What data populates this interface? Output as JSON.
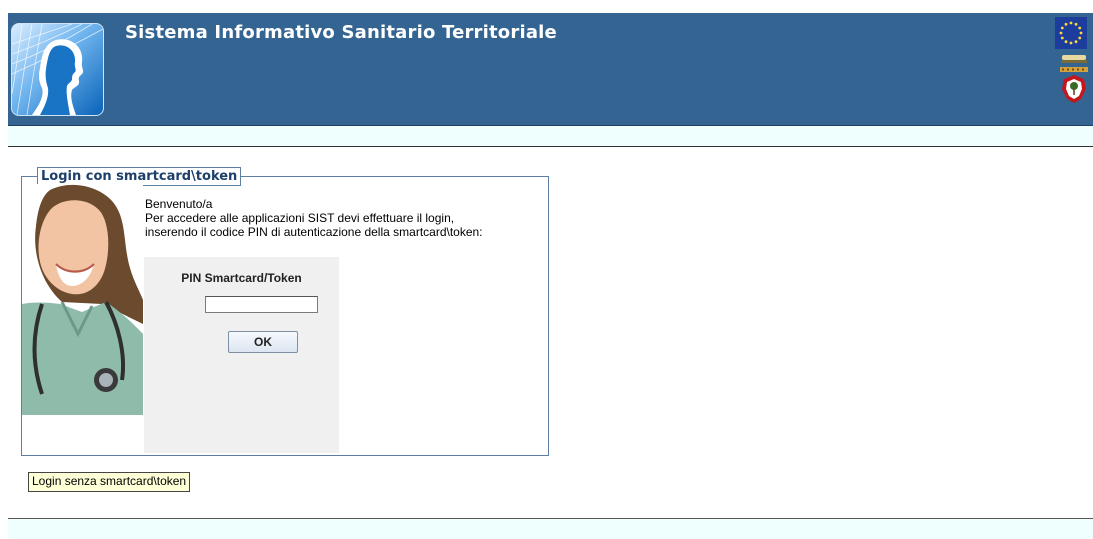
{
  "header": {
    "title": "Sistema Informativo Sanitario Territoriale",
    "background_color": "#346592",
    "logo_icon": "profile-head-logo-icon",
    "eu_flag_icon": "eu-flag-icon",
    "region_crest_icon": "region-crest-icon"
  },
  "login_panel": {
    "legend": "Login con smartcard\\token",
    "welcome_lines": [
      "Benvenuto/a",
      "Per accedere alle applicazioni SIST devi effettuare il login,",
      "inserendo il codice PIN di autenticazione della smartcard\\token:"
    ],
    "pin_label": "PIN Smartcard/Token",
    "pin_value": "",
    "ok_label": "OK"
  },
  "alt_login": {
    "label": "Login senza smartcard\\token"
  }
}
